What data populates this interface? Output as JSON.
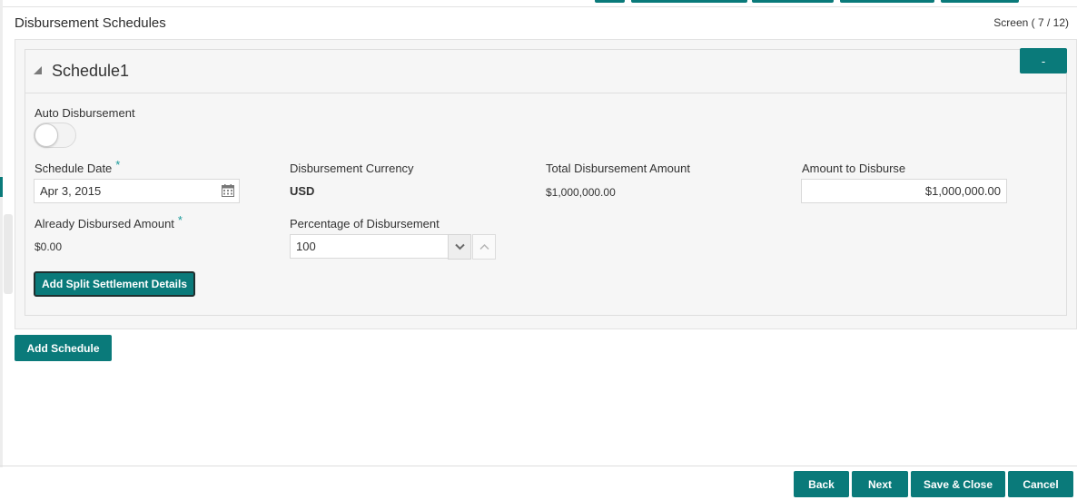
{
  "header": {
    "title": "Disbursement Schedules",
    "screen_indicator": "Screen ( 7 / 12)"
  },
  "schedule": {
    "title": "Schedule1",
    "collapse_label": "-",
    "auto_disbursement": {
      "label": "Auto Disbursement",
      "enabled": false
    },
    "schedule_date": {
      "label": "Schedule Date",
      "required_mark": "*",
      "value": "Apr 3, 2015"
    },
    "disbursement_currency": {
      "label": "Disbursement Currency",
      "value": "USD"
    },
    "total_disbursement_amount": {
      "label": "Total Disbursement Amount",
      "value": "$1,000,000.00"
    },
    "amount_to_disburse": {
      "label": "Amount to Disburse",
      "value": "$1,000,000.00"
    },
    "already_disbursed_amount": {
      "label": "Already Disbursed Amount",
      "required_mark": "*",
      "value": "$0.00"
    },
    "percentage_of_disbursement": {
      "label": "Percentage of Disbursement",
      "value": "100"
    },
    "split_settlement_button": "Add Split Settlement Details"
  },
  "add_schedule_button": "Add Schedule",
  "footer": {
    "back": "Back",
    "next": "Next",
    "save_close": "Save & Close",
    "cancel": "Cancel"
  },
  "colors": {
    "accent": "#0a7a7a",
    "required": "#1a9a9a",
    "panel_bg": "#f6f6f6"
  }
}
